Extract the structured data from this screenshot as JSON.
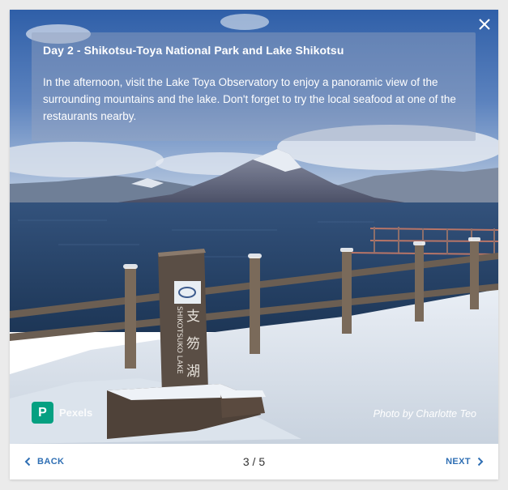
{
  "slide": {
    "title": "Day 2 - Shikotsu-Toya National Park and Lake Shikotsu",
    "description": "In the afternoon, visit the Lake Toya Observatory to enjoy a panoramic view of the surrounding mountains and the lake. Don't forget to try the local seafood at one of the restaurants nearby.",
    "photo_credit": "Photo by Charlotte Teo",
    "provider": "Pexels",
    "provider_badge": "P",
    "sign_text": "SHIKOTSUKO LAKE",
    "sign_kanji": [
      "支",
      "笏",
      "湖"
    ]
  },
  "footer": {
    "back_label": "BACK",
    "next_label": "NEXT",
    "page_indicator": "3 / 5",
    "current_page": 3,
    "total_pages": 5
  },
  "icons": {
    "close": "close-icon",
    "back": "chevron-left-icon",
    "next": "chevron-right-icon",
    "provider": "pexels-logo-icon"
  },
  "colors": {
    "accent": "#2f6fb4",
    "provider_green": "#05a081"
  }
}
